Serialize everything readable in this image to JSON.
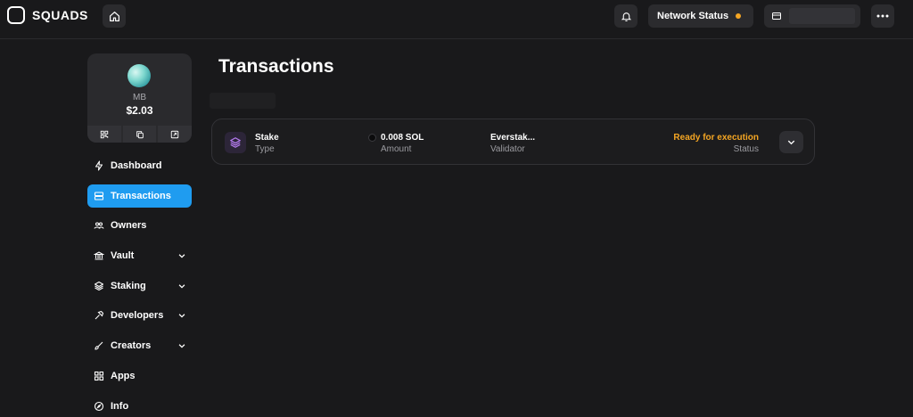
{
  "header": {
    "logo_text": "SQUADS",
    "network_status_label": "Network Status",
    "network_status_color": "#f5a623"
  },
  "vault_card": {
    "name": "MB",
    "balance": "$2.03"
  },
  "sidebar": {
    "items": [
      {
        "label": "Dashboard",
        "icon": "lightning-icon",
        "active": false,
        "expandable": false
      },
      {
        "label": "Transactions",
        "icon": "list-icon",
        "active": true,
        "expandable": false
      },
      {
        "label": "Owners",
        "icon": "users-icon",
        "active": false,
        "expandable": false
      },
      {
        "label": "Vault",
        "icon": "bank-icon",
        "active": false,
        "expandable": true
      },
      {
        "label": "Staking",
        "icon": "layers-icon",
        "active": false,
        "expandable": true
      },
      {
        "label": "Developers",
        "icon": "hammer-icon",
        "active": false,
        "expandable": true
      },
      {
        "label": "Creators",
        "icon": "brush-icon",
        "active": false,
        "expandable": true
      },
      {
        "label": "Apps",
        "icon": "grid-icon",
        "active": false,
        "expandable": false
      },
      {
        "label": "Info",
        "icon": "compass-icon",
        "active": false,
        "expandable": false
      }
    ]
  },
  "main": {
    "title": "Transactions",
    "transactions": [
      {
        "type_value": "Stake",
        "type_label": "Type",
        "amount_value": "0.008 SOL",
        "amount_label": "Amount",
        "validator_value": "Everstak...",
        "validator_label": "Validator",
        "status_value": "Ready for execution",
        "status_label": "Status"
      }
    ]
  },
  "colors": {
    "accent": "#1f9cf0",
    "status_pending": "#f5a623",
    "background": "#19191b"
  }
}
